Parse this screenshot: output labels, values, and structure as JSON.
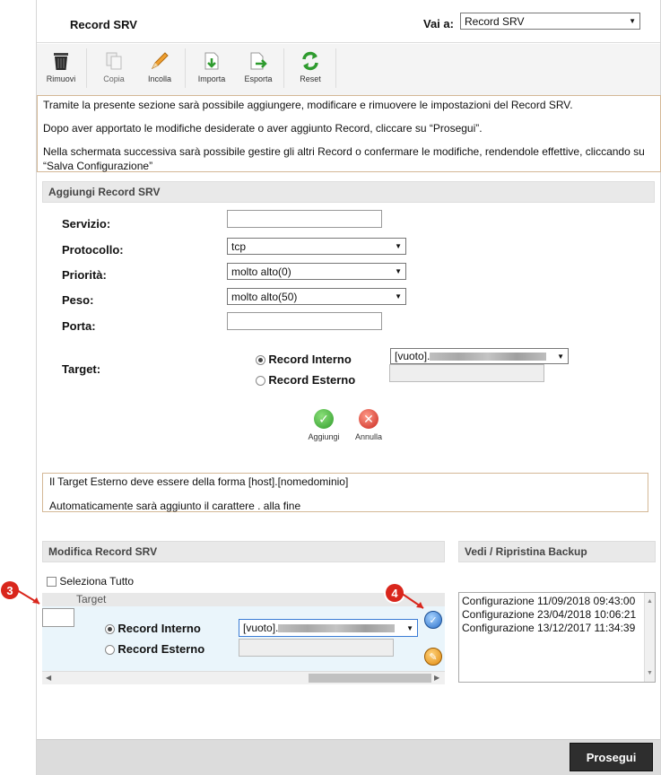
{
  "header": {
    "title": "Record SRV",
    "vai_label": "Vai a:",
    "vai_value": "Record SRV"
  },
  "toolbar": {
    "items": [
      {
        "label": "Rimuovi",
        "icon": "trash-icon"
      },
      {
        "label": "Copia",
        "icon": "copy-icon"
      },
      {
        "label": "Incolla",
        "icon": "pencil-icon"
      },
      {
        "label": "Importa",
        "icon": "import-icon"
      },
      {
        "label": "Esporta",
        "icon": "export-icon"
      },
      {
        "label": "Reset",
        "icon": "reset-icon"
      }
    ]
  },
  "info": {
    "line1": "Tramite la presente sezione sarà possibile aggiungere, modificare e rimuovere le impostazioni del Record SRV.",
    "line2": "Dopo aver apportato le modifiche desiderate o aver aggiunto Record, cliccare su “Prosegui”.",
    "line3": "Nella schermata successiva sarà possibile gestire gli altri Record o confermare le modifiche, rendendole effettive, cliccando su “Salva Configurazione”"
  },
  "add_section": {
    "header": "Aggiungi Record SRV",
    "servizio_label": "Servizio:",
    "servizio_value": "",
    "protocollo_label": "Protocollo:",
    "protocollo_value": "tcp",
    "priorita_label": "Priorità:",
    "priorita_value": "molto alto(0)",
    "peso_label": "Peso:",
    "peso_value": "molto alto(50)",
    "porta_label": "Porta:",
    "porta_value": "",
    "target_label": "Target:",
    "radio_interno": "Record Interno",
    "radio_esterno": "Record Esterno",
    "target_select_value": "[vuoto].",
    "aggiungi_label": "Aggiungi",
    "annulla_label": "Annulla"
  },
  "note": {
    "line1": "Il Target Esterno deve essere della forma [host].[nomedominio]",
    "line2": "Automaticamente sarà aggiunto il carattere . alla fine"
  },
  "modify_section": {
    "header": "Modifica Record SRV",
    "select_all_label": "Seleziona Tutto",
    "column_target": "Target",
    "radio_interno": "Record Interno",
    "radio_esterno": "Record Esterno",
    "target_select_value": "[vuoto]."
  },
  "backup_section": {
    "header": "Vedi / Ripristina Backup",
    "items": [
      "Configurazione 11/09/2018 09:43:00",
      "Configurazione 23/04/2018 10:06:21",
      "Configurazione 13/12/2017 11:34:39"
    ]
  },
  "markers": {
    "m3": "3",
    "m4": "4"
  },
  "footer": {
    "prosegui_label": "Prosegui"
  }
}
